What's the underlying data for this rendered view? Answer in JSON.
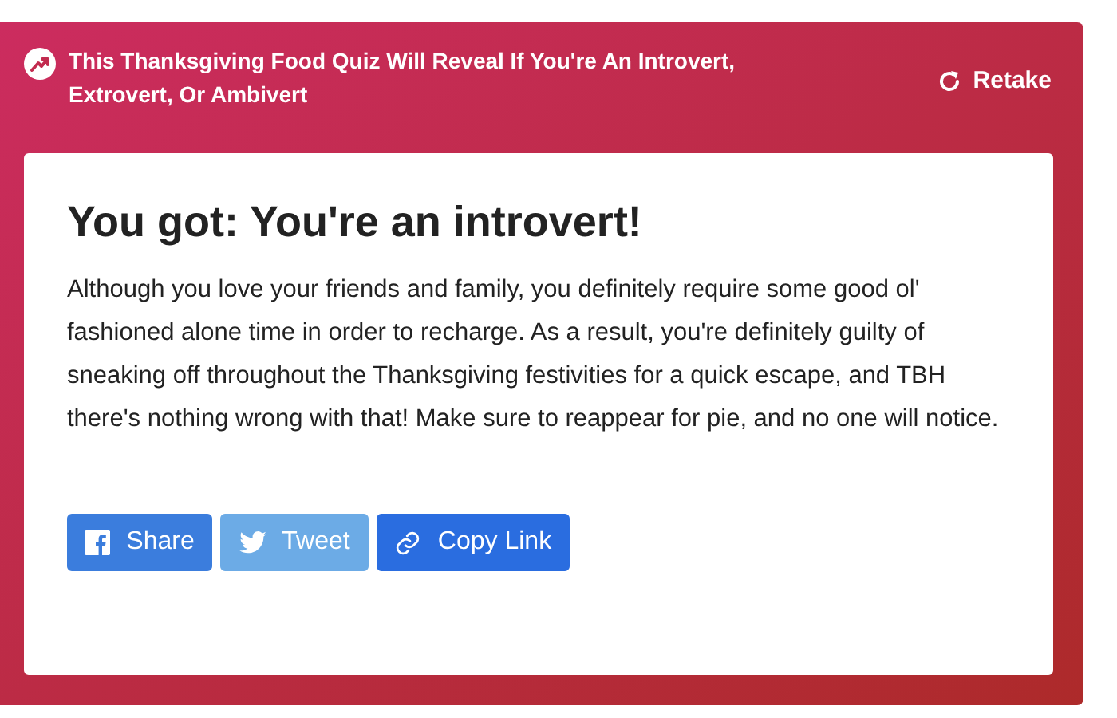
{
  "header": {
    "quiz_title": "This Thanksgiving Food Quiz Will Reveal If You're An Introvert, Extrovert, Or Ambivert",
    "retake": "Retake"
  },
  "result": {
    "title": "You got: You're an introvert!",
    "description": "Although you love your friends and family, you definitely require some good ol' fashioned alone time in order to recharge. As a result, you're definitely guilty of sneaking off throughout the Thanksgiving festivities for a quick escape, and TBH there's nothing wrong with that! Make sure to reappear for pie, and no one will notice."
  },
  "share_buttons": [
    {
      "kind": "facebook",
      "label": "Share"
    },
    {
      "kind": "twitter",
      "label": "Tweet"
    },
    {
      "kind": "link",
      "label": "Copy Link"
    }
  ]
}
